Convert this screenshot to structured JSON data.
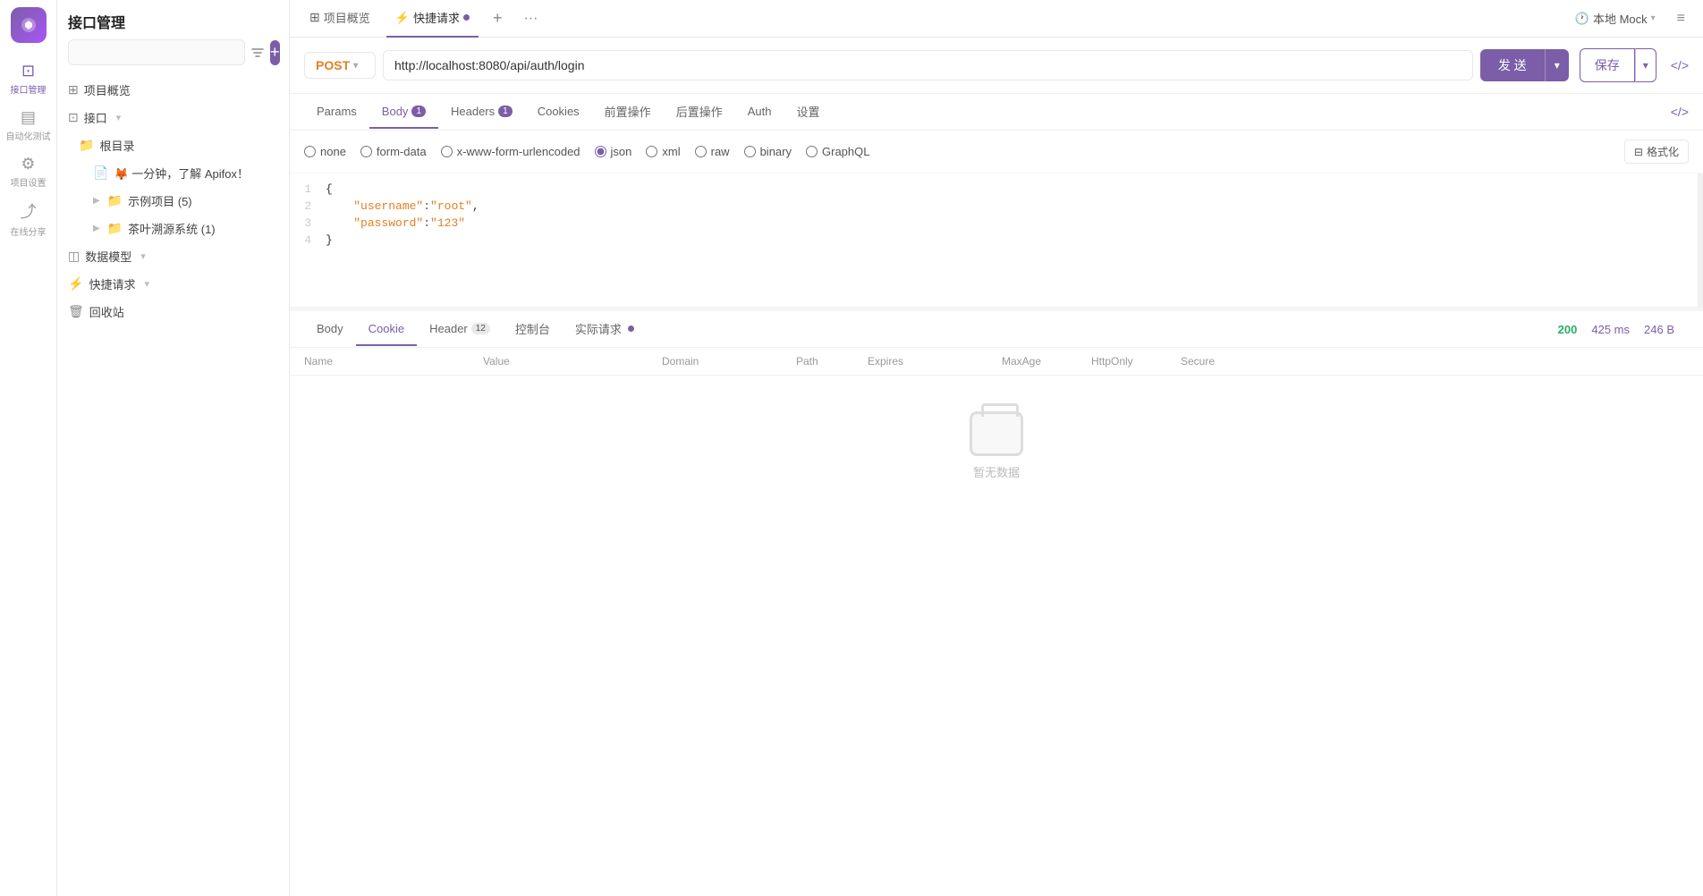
{
  "app": {
    "title": "接口管理"
  },
  "icon_sidebar": {
    "nav_items": [
      {
        "id": "interface",
        "label": "接口管理",
        "icon": "⬛",
        "active": true
      },
      {
        "id": "autotest",
        "label": "自动化测试",
        "icon": "▦"
      },
      {
        "id": "project",
        "label": "项目设置",
        "icon": "⚙"
      },
      {
        "id": "share",
        "label": "在线分享",
        "icon": "↗"
      }
    ]
  },
  "left_panel": {
    "search_placeholder": "",
    "tree_items": [
      {
        "id": "overview",
        "label": "项目概览",
        "icon": "⊞",
        "level": 0
      },
      {
        "id": "interface",
        "label": "接口",
        "icon": "⊡",
        "level": 0,
        "has_menu": true
      },
      {
        "id": "root",
        "label": "根目录",
        "icon": "📁",
        "level": 1
      },
      {
        "id": "apifox_intro",
        "label": "🦊 一分钟，了解 Apifox！",
        "icon": "📄",
        "level": 2
      },
      {
        "id": "example_proj",
        "label": "示例项目 (5)",
        "icon": "📁",
        "level": 2,
        "expandable": true
      },
      {
        "id": "tea_system",
        "label": "茶叶溯源系统 (1)",
        "icon": "📁",
        "level": 2,
        "expandable": true
      },
      {
        "id": "data_model",
        "label": "数据模型",
        "icon": "◫",
        "level": 0,
        "has_menu": true
      },
      {
        "id": "quick_req",
        "label": "快捷请求",
        "icon": "⚡",
        "level": 0,
        "has_menu": true
      },
      {
        "id": "trash",
        "label": "回收站",
        "icon": "🗑",
        "level": 0
      }
    ]
  },
  "tabs_bar": {
    "tabs": [
      {
        "id": "overview",
        "label": "项目概览",
        "icon": "⊞",
        "active": false
      },
      {
        "id": "quickreq",
        "label": "快捷请求",
        "icon": "⚡",
        "active": true,
        "has_dot": true
      }
    ],
    "add_label": "+",
    "more_label": "···",
    "mock_label": "本地 Mock",
    "mock_icon": "🕐",
    "menu_icon": "≡"
  },
  "request": {
    "method": "POST",
    "method_color": "#e67e22",
    "url": "http://localhost:8080/api/auth/login",
    "send_label": "发 送",
    "save_label": "保存",
    "tabs": [
      {
        "id": "params",
        "label": "Params",
        "active": false
      },
      {
        "id": "body",
        "label": "Body",
        "count": "1",
        "active": true
      },
      {
        "id": "headers",
        "label": "Headers",
        "count": "1",
        "active": false
      },
      {
        "id": "cookies",
        "label": "Cookies",
        "active": false
      },
      {
        "id": "prerequest",
        "label": "前置操作",
        "active": false
      },
      {
        "id": "postrequest",
        "label": "后置操作",
        "active": false
      },
      {
        "id": "auth",
        "label": "Auth",
        "active": false
      },
      {
        "id": "settings",
        "label": "设置",
        "active": false
      }
    ],
    "body_types": [
      {
        "id": "none",
        "label": "none"
      },
      {
        "id": "form-data",
        "label": "form-data"
      },
      {
        "id": "x-www-form-urlencoded",
        "label": "x-www-form-urlencoded"
      },
      {
        "id": "json",
        "label": "json",
        "selected": true
      },
      {
        "id": "xml",
        "label": "xml"
      },
      {
        "id": "raw",
        "label": "raw"
      },
      {
        "id": "binary",
        "label": "binary"
      },
      {
        "id": "graphql",
        "label": "GraphQL"
      }
    ],
    "format_btn": "格式化",
    "code_lines": [
      {
        "num": "1",
        "content": "{"
      },
      {
        "num": "2",
        "content": "    \"username\":\"root\","
      },
      {
        "num": "3",
        "content": "    \"password\":\"123\""
      },
      {
        "num": "4",
        "content": "}"
      }
    ]
  },
  "response": {
    "tabs": [
      {
        "id": "body",
        "label": "Body",
        "active": false
      },
      {
        "id": "cookie",
        "label": "Cookie",
        "active": true
      },
      {
        "id": "header",
        "label": "Header",
        "count": "12",
        "active": false
      },
      {
        "id": "console",
        "label": "控制台",
        "active": false
      },
      {
        "id": "actual",
        "label": "实际请求",
        "has_dot": true,
        "active": false
      }
    ],
    "status": "200",
    "time": "425 ms",
    "size": "246 B",
    "cookie_columns": [
      "Name",
      "Value",
      "Domain",
      "Path",
      "Expires",
      "MaxAge",
      "HttpOnly",
      "Secure"
    ],
    "empty_text": "暂无数据"
  }
}
